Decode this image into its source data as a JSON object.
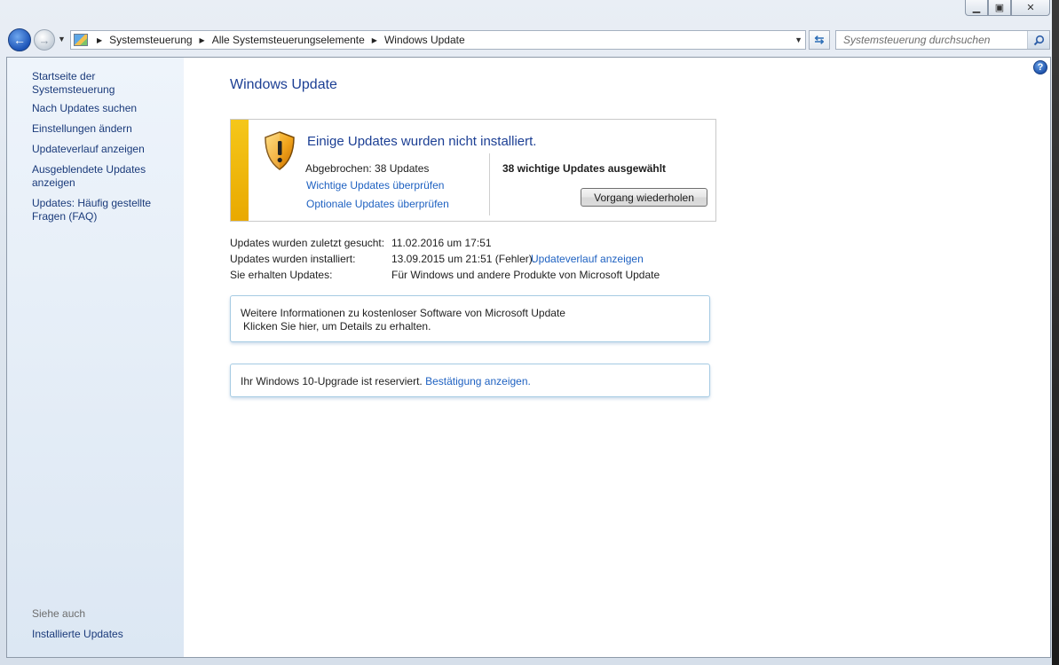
{
  "window": {
    "minimize_glyph": "▁",
    "maximize_glyph": "▣",
    "close_glyph": "✕"
  },
  "nav": {
    "back_glyph": "←",
    "forward_glyph": "→",
    "breadcrumbs": [
      "Systemsteuerung",
      "Alle Systemsteuerungselemente",
      "Windows Update"
    ],
    "search_placeholder": "Systemsteuerung durchsuchen"
  },
  "sidebar": {
    "home": "Startseite der Systemsteuerung",
    "items": [
      "Nach Updates suchen",
      "Einstellungen ändern",
      "Updateverlauf anzeigen",
      "Ausgeblendete Updates anzeigen",
      "Updates: Häufig gestellte Fragen (FAQ)"
    ],
    "see_also_heading": "Siehe auch",
    "see_also_items": [
      "Installierte Updates"
    ]
  },
  "main": {
    "title": "Windows Update",
    "status": {
      "title": "Einige Updates wurden nicht installiert.",
      "aborted": "Abgebrochen: 38 Updates",
      "link_important": "Wichtige Updates überprüfen",
      "link_optional": "Optionale Updates überprüfen",
      "selected": "38 wichtige Updates ausgewählt",
      "retry_button": "Vorgang wiederholen",
      "strip_color": "#f2bc12"
    },
    "info": {
      "last_search_label": "Updates wurden zuletzt gesucht:",
      "last_search_value": "11.02.2016 um 17:51",
      "installed_label": "Updates wurden installiert:",
      "installed_value": "13.09.2015 um 21:51 (Fehler).",
      "installed_link": "Updateverlauf anzeigen",
      "receive_label": "Sie erhalten Updates:",
      "receive_value": "Für Windows und andere Produkte von Microsoft Update"
    },
    "card_software": {
      "text": "Weitere Informationen zu kostenloser Software von Microsoft Update",
      "link": "Klicken Sie hier, um Details zu erhalten."
    },
    "card_upgrade": {
      "text": "Ihr Windows 10-Upgrade ist reserviert.",
      "link": "Bestätigung anzeigen."
    }
  }
}
